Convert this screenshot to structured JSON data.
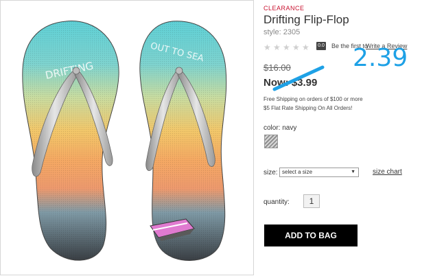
{
  "product": {
    "badge": "CLEARANCE",
    "title": "Drifting Flip-Flop",
    "style": "style: 2305",
    "rating": {
      "stars": [
        "★",
        "★",
        "★",
        "★",
        "★"
      ],
      "value": "0.0",
      "be_first": "Be the first to",
      "write_review": "Write a Review"
    },
    "price": {
      "old": "$16.00",
      "now": "Now: $3.99"
    },
    "shipping": {
      "line1": "Free Shipping on orders of $100 or more",
      "line2": "$5 Flat Rate Shipping On All Orders!"
    },
    "color": {
      "label": "color: navy"
    },
    "size": {
      "label": "size:",
      "selected": "select a size",
      "arrow": "▼",
      "chart_link": "size chart"
    },
    "quantity": {
      "label": "quantity:",
      "value": "1"
    },
    "add_to_bag": "ADD TO BAG"
  },
  "image": {
    "left_sandal_text": "DRIFTING",
    "right_sandal_text": "OUT TO SEA"
  },
  "overlay": {
    "number": "2.39",
    "color": "#1ea1e6"
  }
}
